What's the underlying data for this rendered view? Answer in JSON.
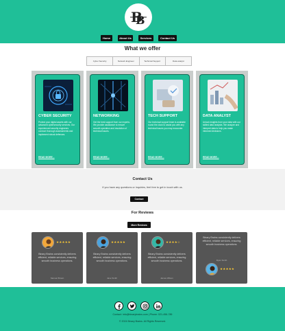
{
  "header": {
    "logo_text": "BB",
    "nav": [
      {
        "label": "Home"
      },
      {
        "label": "About Us"
      },
      {
        "label": "Services"
      },
      {
        "label": "Contact Us"
      }
    ]
  },
  "offer": {
    "title": "What we offer",
    "tabs": [
      "Cyber Security",
      "Network Engineer",
      "Technical Support",
      "Data analyst"
    ]
  },
  "cards": [
    {
      "title": "CYBER SECURITY",
      "text": "Protect your digital assets with our advanced cybersecurity services. Our experienced security engineers conduct thorough assessments and implement robust defenses.",
      "link": "READ MORE..."
    },
    {
      "title": "NETWORKING",
      "text": "Get the best support from our experts. We provide assistance to ensure smooth operation and resolution of technical issues.",
      "link": "READ MORE..."
    },
    {
      "title": "TECH SUPPORT",
      "text": "Our technical support team is available round the clock to assist you with any technical issues you may encounter.",
      "link": "READ MORE..."
    },
    {
      "title": "DATA ANALYST",
      "text": "Unlock insights from your data with our skilled data analysts. We analyze and interpret data to help you make informed decisions.",
      "link": "READ MORE..."
    }
  ],
  "contact": {
    "title": "Contact Us",
    "text": "If you have any questions or inquiries, feel free to get in touch with us.",
    "button": "Contact"
  },
  "reviews": {
    "title": "For Reviews",
    "more_button": "More Reviews",
    "items": [
      {
        "stars": "★★★★★",
        "text": "Binary Brains consistently delivers efficient, reliable services, ensuring smooth business operations.",
        "name": "Samuel Brown"
      },
      {
        "stars": "★★★★★",
        "text": "Binary Brains consistently delivers efficient, reliable services, ensuring smooth business operations.",
        "name": "Jane Smith"
      },
      {
        "stars": "★★★★☆",
        "text": "Binary Brains consistently delivers efficient, reliable services, ensuring smooth business operations.",
        "name": "James Wilson"
      },
      {
        "stars": "★★★★★",
        "text": "Binary Brains consistently delivers efficient, reliable services, ensuring smooth business operations.",
        "name": "Ryan Smith"
      }
    ]
  },
  "footer": {
    "socials": [
      "facebook-icon",
      "twitter-icon",
      "instagram-icon",
      "linkedin-icon"
    ],
    "contact": "Contact: info@binarybrains.com | Phone: 021-456-789",
    "copyright": "© 2024 Binary Brains. All Rights Reserved."
  },
  "colors": {
    "accent": "#1fbf98",
    "dark": "#111111",
    "card_bg": "#555555"
  }
}
